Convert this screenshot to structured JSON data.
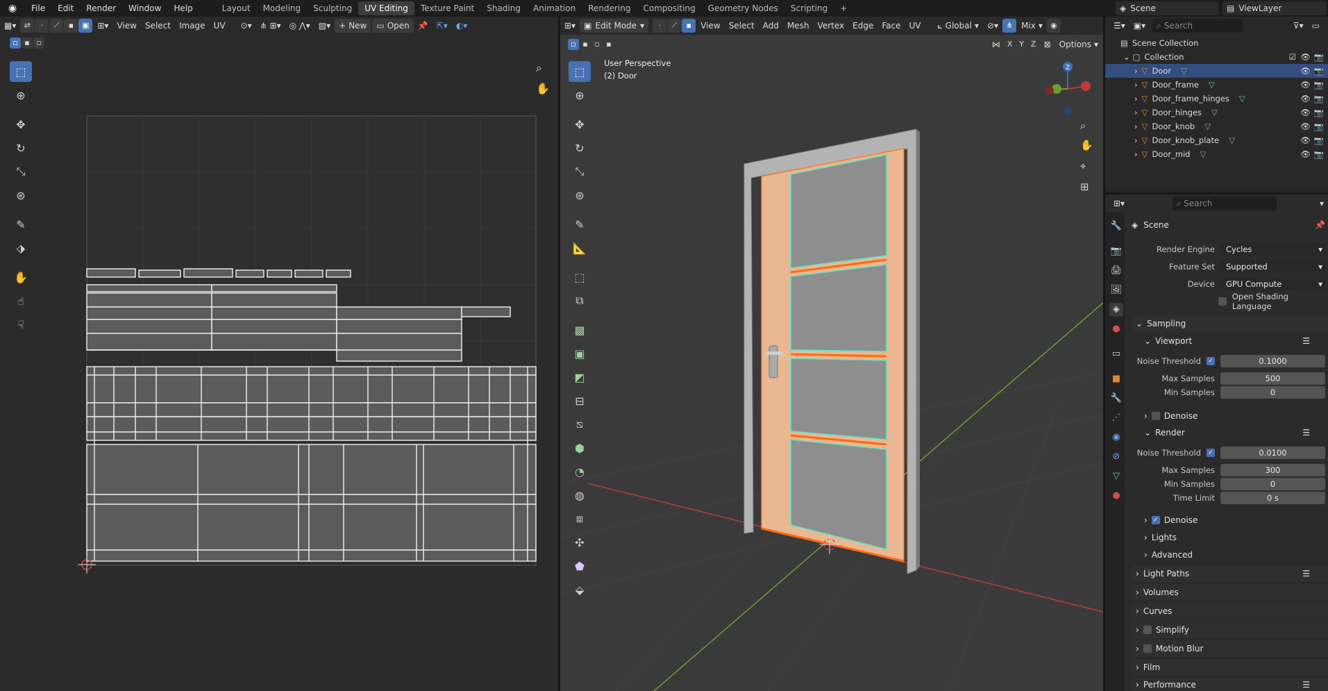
{
  "topbar": {
    "menus": [
      "File",
      "Edit",
      "Render",
      "Window",
      "Help"
    ],
    "workspaces": [
      "Layout",
      "Modeling",
      "Sculpting",
      "UV Editing",
      "Texture Paint",
      "Shading",
      "Animation",
      "Rendering",
      "Compositing",
      "Geometry Nodes",
      "Scripting"
    ],
    "active_workspace": "UV Editing",
    "add_tab": "+",
    "scene": "Scene",
    "view_layer": "ViewLayer"
  },
  "uv_editor": {
    "menus": [
      "View",
      "Select",
      "Image",
      "UV"
    ],
    "new_label": "New",
    "open_label": "Open"
  },
  "viewport": {
    "mode": "Edit Mode",
    "menus": [
      "View",
      "Select",
      "Add",
      "Mesh",
      "Vertex",
      "Edge",
      "Face",
      "UV"
    ],
    "orientation": "Global",
    "shading": "Mix",
    "options": "Options",
    "title": "User Perspective",
    "subtitle": "(2) Door",
    "axes": [
      "X",
      "Y",
      "Z"
    ]
  },
  "outliner": {
    "search_placeholder": "Search",
    "collection_root": "Scene Collection",
    "collection": "Collection",
    "items": [
      "Door",
      "Door_frame",
      "Door_frame_hinges",
      "Door_hinges",
      "Door_knob",
      "Door_knob_plate",
      "Door_mid"
    ],
    "selected": "Door"
  },
  "properties": {
    "search_placeholder": "Search",
    "context": "Scene",
    "render_engine_label": "Render Engine",
    "render_engine": "Cycles",
    "feature_set_label": "Feature Set",
    "feature_set": "Supported",
    "device_label": "Device",
    "device": "GPU Compute",
    "osl_label": "Open Shading Language",
    "sampling": "Sampling",
    "viewport_panel": "Viewport",
    "render_panel": "Render",
    "vp_noise_label": "Noise Threshold",
    "vp_noise": "0.1000",
    "vp_max_label": "Max Samples",
    "vp_max": "500",
    "vp_min_label": "Min Samples",
    "vp_min": "0",
    "vp_denoise": "Denoise",
    "r_noise_label": "Noise Threshold",
    "r_noise": "0.0100",
    "r_max_label": "Max Samples",
    "r_max": "300",
    "r_min_label": "Min Samples",
    "r_min": "0",
    "r_time_label": "Time Limit",
    "r_time": "0 s",
    "r_denoise": "Denoise",
    "lights": "Lights",
    "advanced": "Advanced",
    "light_paths": "Light Paths",
    "volumes": "Volumes",
    "curves": "Curves",
    "simplify": "Simplify",
    "motion_blur": "Motion Blur",
    "film": "Film",
    "performance": "Performance"
  },
  "colors": {
    "accent": "#4772b3",
    "selected_edge": "#ff7a22",
    "seam": "#66e0c8",
    "x_axis": "#c0393b",
    "y_axis": "#6b9e2f",
    "z_axis": "#3a6fbf"
  }
}
